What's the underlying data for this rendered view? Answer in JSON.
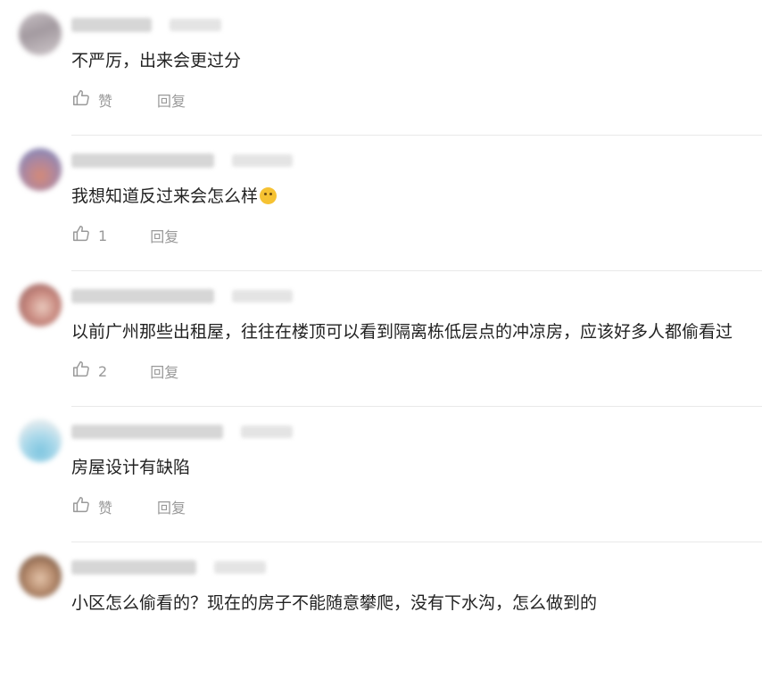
{
  "comments": [
    {
      "text": "不严厉，出来会更过分",
      "like_label": "赞",
      "reply_label": "回复",
      "emoji": false
    },
    {
      "text": "我想知道反过来会怎么样",
      "like_label": "1",
      "reply_label": "回复",
      "emoji": true
    },
    {
      "text": "以前广州那些出租屋，往往在楼顶可以看到隔离栋低层点的冲凉房，应该好多人都偷看过",
      "like_label": "2",
      "reply_label": "回复",
      "emoji": false
    },
    {
      "text": "房屋设计有缺陷",
      "like_label": "赞",
      "reply_label": "回复",
      "emoji": false
    },
    {
      "text": "小区怎么偷看的？现在的房子不能随意攀爬，没有下水沟，怎么做到的",
      "like_label": "",
      "reply_label": "",
      "emoji": false
    }
  ],
  "icons": {
    "like": "thumbs-up-icon",
    "emoji": "face-emoji-icon"
  },
  "colors": {
    "text": "#222222",
    "meta": "#999999",
    "divider": "#e9e9e9"
  }
}
